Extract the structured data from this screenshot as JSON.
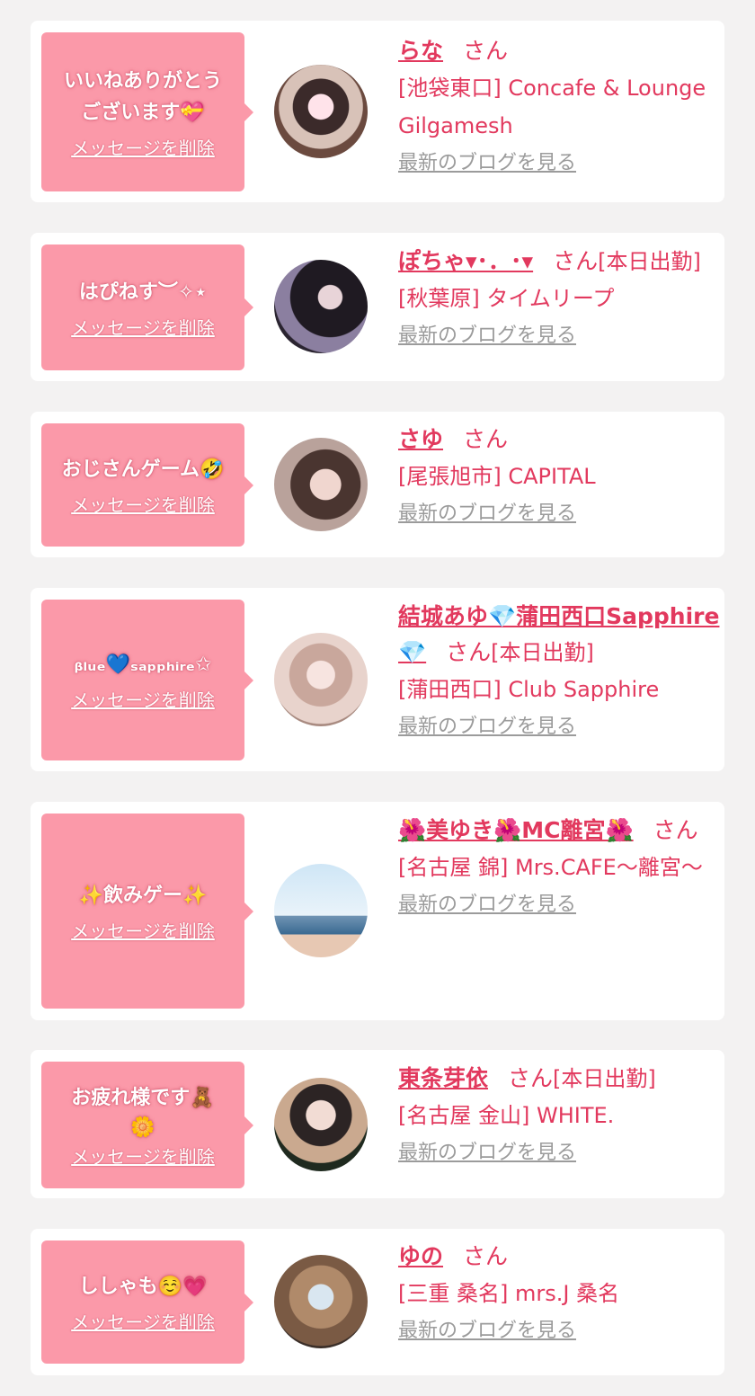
{
  "common": {
    "delete_label": "メッセージを削除",
    "san": "さん",
    "blog_label": "最新のブログを見る"
  },
  "colors": {
    "page_bg": "#f3f2f2",
    "bubble": "#fb99a9",
    "accent": "#e2395e",
    "link_gray": "#9b9b9b"
  },
  "cards": [
    {
      "message": "いいねありがとう\nございます💝",
      "name": "らな",
      "duty": "",
      "shop": "[池袋東口] Concafe & Lounge Gilgamesh"
    },
    {
      "message": "はぴねす︶✧︎⋆",
      "name": "ぽちゃ▾･．･▾",
      "duty": "[本日出勤]",
      "shop": "[秋葉原] タイムリープ"
    },
    {
      "message": "おじさんゲーム🤣",
      "name": "さゆ",
      "duty": "",
      "shop": "[尾張旭市] CAPITAL"
    },
    {
      "message": "ᵦₗᵤₑ💙ₛₐₚₚₕᵢᵣₑ✩",
      "name": "結城あゆ💎蒲田西口Sapphire💎",
      "duty": "[本日出勤]",
      "shop": "[蒲田西口] Club Sapphire"
    },
    {
      "message": "✨飲みゲー✨",
      "name": "🌺美ゆき🌺MC離宮🌺",
      "duty": "",
      "shop": "[名古屋 錦] Mrs.CAFE〜離宮〜"
    },
    {
      "message": "お疲れ様です🧸\n🌼",
      "name": "東条芽依",
      "duty": "[本日出勤]",
      "shop": "[名古屋 金山] WHITE."
    },
    {
      "message": "ししゃも☺️💗",
      "name": "ゆの",
      "duty": "",
      "shop": "[三重 桑名] mrs.J 桑名"
    }
  ]
}
